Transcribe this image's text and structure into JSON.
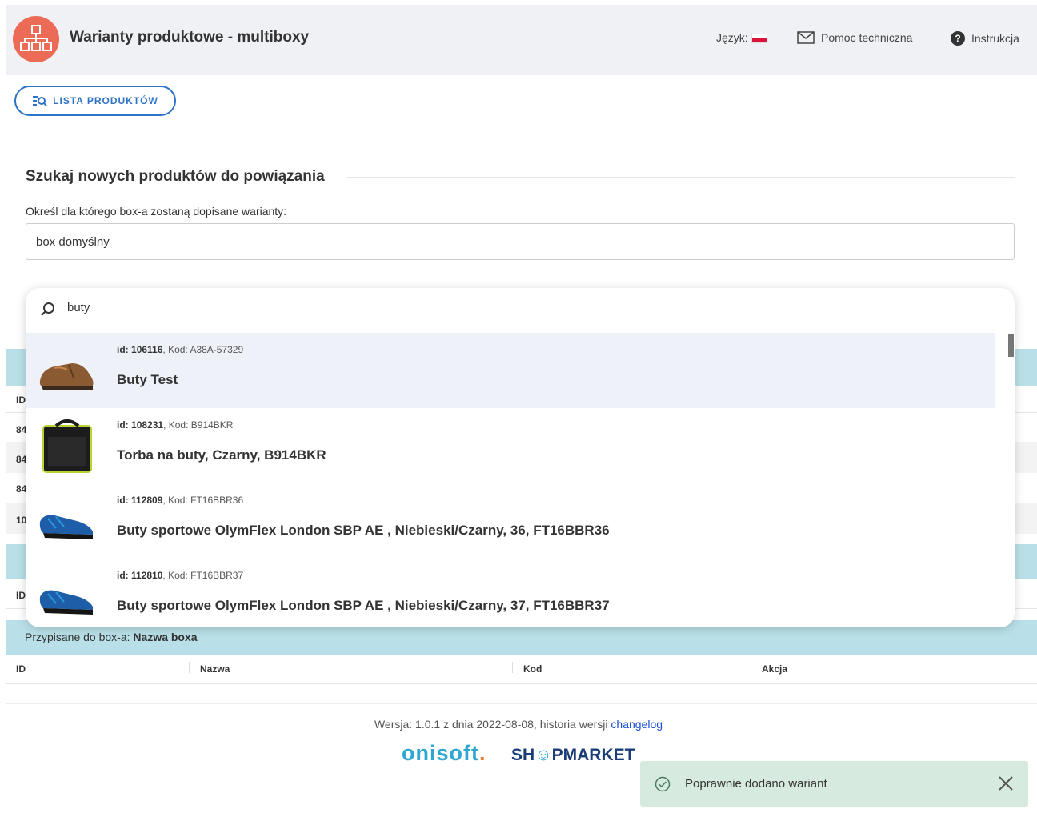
{
  "header": {
    "title": "Warianty produktowe - multiboxy",
    "language_label": "Język:",
    "help_label": "Pomoc techniczna",
    "instruction_label": "Instrukcja"
  },
  "toolbar": {
    "product_list_label": "LISTA PRODUKTÓW"
  },
  "search_section": {
    "title": "Szukaj nowych produktów do powiązania",
    "box_label": "Określ dla którego box-a zostaną dopisane warianty:",
    "box_value": "box domyślny",
    "query": "buty"
  },
  "results": [
    {
      "id_label": "id:",
      "id": "106116",
      "code_label": "Kod:",
      "code": "A38A-57329",
      "name": "Buty Test"
    },
    {
      "id_label": "id:",
      "id": "108231",
      "code_label": "Kod:",
      "code": "B914BKR",
      "name": "Torba na buty, Czarny, B914BKR"
    },
    {
      "id_label": "id:",
      "id": "112809",
      "code_label": "Kod:",
      "code": "FT16BBR36",
      "name": "Buty sportowe OlymFlex London SBP AE , Niebieski/Czarny, 36, FT16BBR36"
    },
    {
      "id_label": "id:",
      "id": "112810",
      "code_label": "Kod:",
      "code": "FT16BBR37",
      "name": "Buty sportowe OlymFlex London SBP AE , Niebieski/Czarny, 37, FT16BBR37"
    }
  ],
  "background_table": {
    "id_header": "ID",
    "row_ids": [
      "84",
      "84",
      "84",
      "10"
    ],
    "assigned_prefix": "Przypisane do box-a:",
    "assigned_box": "Nazwa boxa",
    "columns": [
      "ID",
      "Nazwa",
      "Kod",
      "Akcja"
    ]
  },
  "footer": {
    "version_text": "Wersja: 1.0.1 z dnia 2022-08-08, historia wersji",
    "changelog_label": "changelog",
    "brand_onisoft": "onisoft",
    "brand_onisoft_dot": ".",
    "brand_shop_a": "SH",
    "brand_shop_o": "☺",
    "brand_shop_b": "PMARKET"
  },
  "toast": {
    "message": "Poprawnie dodano wariant"
  },
  "colors": {
    "accent": "#2c73c6",
    "logo": "#ec6b57",
    "band": "#b9e0e8",
    "toast_bg": "#d7eadf"
  }
}
